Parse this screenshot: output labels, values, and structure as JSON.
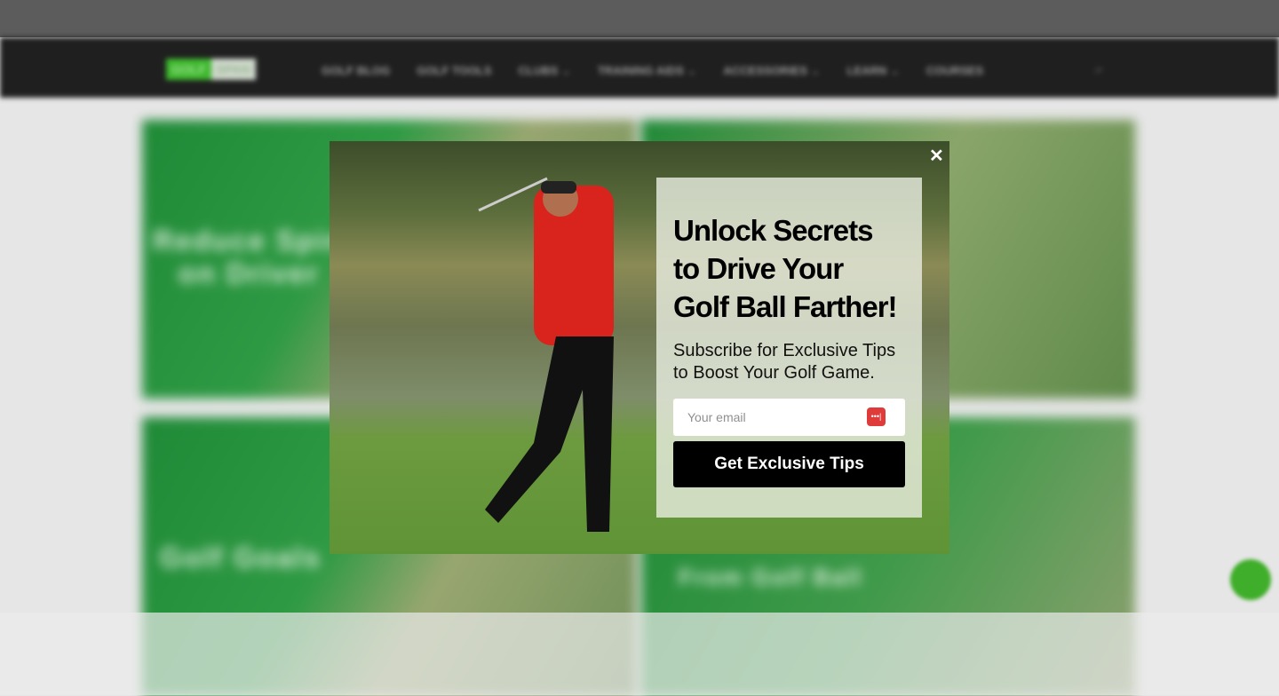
{
  "nav": {
    "logo_left": "GOLF",
    "logo_right": "SPAN",
    "items": [
      {
        "label": "GOLF BLOG",
        "dropdown": false
      },
      {
        "label": "GOLF TOOLS",
        "dropdown": false
      },
      {
        "label": "CLUBS",
        "dropdown": true
      },
      {
        "label": "TRAINING AIDS",
        "dropdown": true
      },
      {
        "label": "ACCESSORIES",
        "dropdown": true
      },
      {
        "label": "LEARN",
        "dropdown": true
      },
      {
        "label": "COURSES",
        "dropdown": false
      }
    ],
    "search_icon": "search-icon"
  },
  "cards": [
    {
      "title": "Reduce Spin on Driver"
    },
    {
      "title": ""
    },
    {
      "title": "Golf Goals"
    },
    {
      "title": "From Golf Ball"
    }
  ],
  "modal": {
    "close_label": "✕",
    "headline": "Unlock Secrets to Drive Your Golf Ball Farther!",
    "subheadline": "Subscribe for Exclusive Tips to Boost Your Golf Game.",
    "email_placeholder": "Your email",
    "email_value": "",
    "password_manager_icon": "•••|",
    "submit_label": "Get Exclusive Tips"
  },
  "colors": {
    "brand_green": "#3fb82f",
    "button": "#000000",
    "pw_icon": "#e03b3b"
  }
}
